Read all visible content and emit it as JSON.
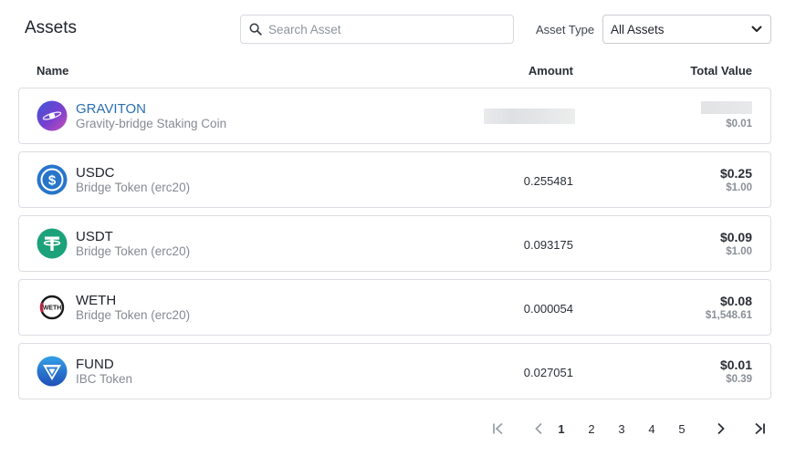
{
  "header": {
    "title": "Assets",
    "search_placeholder": "Search Asset",
    "search_value": "",
    "asset_type_label": "Asset Type",
    "asset_type_selected": "All Assets"
  },
  "columns": {
    "name": "Name",
    "amount": "Amount",
    "total_value": "Total Value"
  },
  "assets": [
    {
      "symbol": "GRAVITON",
      "description": "Gravity-bridge Staking Coin",
      "amount": "",
      "total": "",
      "usd": "$0.01",
      "icon": "graviton-logo-icon",
      "accent": "#2a6fb0"
    },
    {
      "symbol": "USDC",
      "description": "Bridge Token (erc20)",
      "amount": "0.255481",
      "total": "$0.25",
      "usd": "$1.00",
      "icon": "usdc-logo-icon",
      "accent": "#2775ca"
    },
    {
      "symbol": "USDT",
      "description": "Bridge Token (erc20)",
      "amount": "0.093175",
      "total": "$0.09",
      "usd": "$1.00",
      "icon": "usdt-logo-icon",
      "accent": "#1ba27a"
    },
    {
      "symbol": "WETH",
      "description": "Bridge Token (erc20)",
      "amount": "0.000054",
      "total": "$0.08",
      "usd": "$1,548.61",
      "icon": "weth-logo-icon",
      "accent": "#8b1a2b"
    },
    {
      "symbol": "FUND",
      "description": "IBC Token",
      "amount": "0.027051",
      "total": "$0.01",
      "usd": "$0.39",
      "icon": "fund-logo-icon",
      "accent": "#2a6cc8"
    }
  ],
  "pagination": {
    "pages": [
      "1",
      "2",
      "3",
      "4",
      "5"
    ],
    "current": "1"
  }
}
